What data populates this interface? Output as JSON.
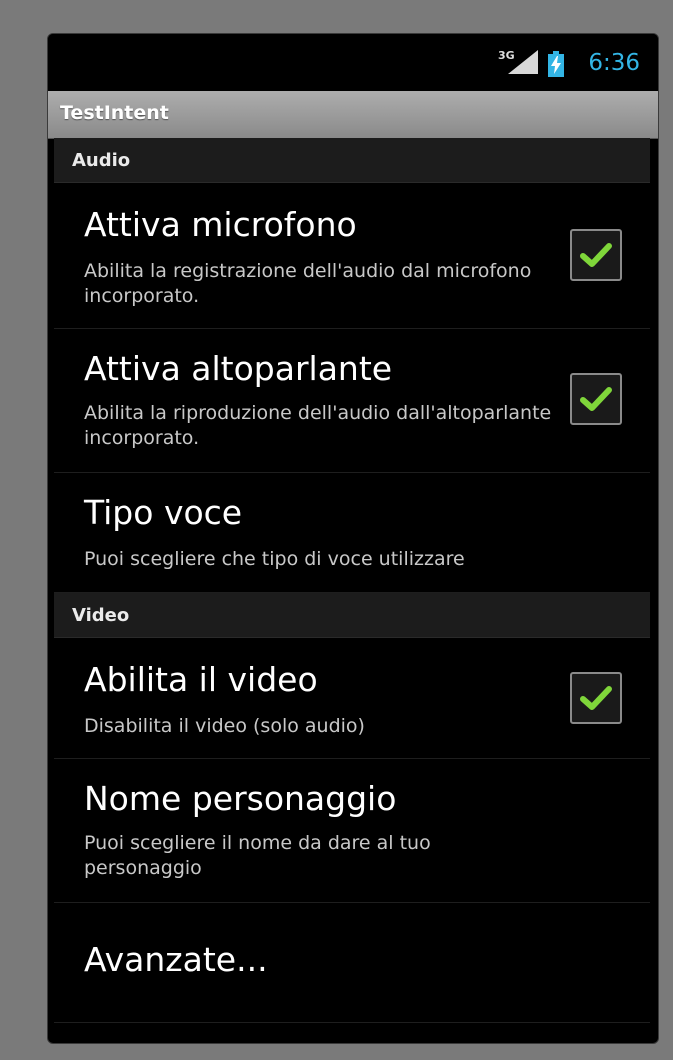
{
  "status_bar": {
    "network_label": "3G",
    "time": "6:36",
    "time_color": "#33b5e5",
    "icons": [
      "signal-icon",
      "battery-charging-icon"
    ]
  },
  "app": {
    "title": "TestIntent"
  },
  "categories": {
    "audio": "Audio",
    "video": "Video"
  },
  "preferences": {
    "microphone": {
      "title": "Attiva microfono",
      "summary": "Abilita la registrazione dell'audio dal microfono incorporato.",
      "checked": true
    },
    "speaker": {
      "title": "Attiva altoparlante",
      "summary": "Abilita la riproduzione dell'audio dall'altoparlante incorporato.",
      "checked": true
    },
    "voice_type": {
      "title": "Tipo voce",
      "summary": "Puoi scegliere che tipo di voce utilizzare"
    },
    "video": {
      "title": "Abilita il video",
      "summary": "Disabilita il video (solo audio)",
      "checked": true
    },
    "character_name": {
      "title": "Nome personaggio",
      "summary": "Puoi scegliere il nome da dare al tuo personaggio"
    },
    "advanced": {
      "title": "Avanzate..."
    }
  },
  "check_color": "#7fd63a"
}
